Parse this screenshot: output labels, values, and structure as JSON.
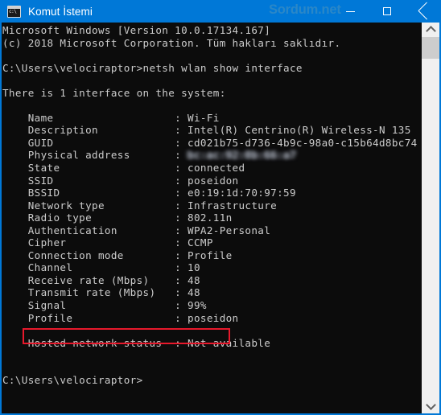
{
  "window": {
    "title": "Komut İstemi",
    "app_icon": "cmd-console-icon",
    "watermark": "Sordum.net",
    "controls": {
      "minimize_label": "Minimize",
      "maximize_label": "Maximize",
      "close_label": "Close"
    },
    "accent_color": "#0078d7",
    "console_bg": "#0c0c0c",
    "console_fg": "#cccccc",
    "highlight_color": "#e8192c"
  },
  "console": {
    "lines": [
      {
        "text": "Microsoft Windows [Version 10.0.17134.167]"
      },
      {
        "text": "(c) 2018 Microsoft Corporation. Tüm hakları saklıdır."
      },
      {
        "text": ""
      },
      {
        "text": "C:\\Users\\velociraptor>netsh wlan show interface"
      },
      {
        "text": ""
      },
      {
        "text": "There is 1 interface on the system:"
      },
      {
        "text": ""
      },
      {
        "text": "    Name                   : Wi-Fi"
      },
      {
        "text": "    Description            : Intel(R) Centrino(R) Wireless-N 135"
      },
      {
        "text": "    GUID                   : cd021b75-d736-4b9c-98a0-c15b64d8bc74"
      },
      {
        "text": "    Physical address       : ",
        "blurred_suffix": "bc:ac:92:0b:66:a7",
        "redacted": true
      },
      {
        "text": "    State                  : connected"
      },
      {
        "text": "    SSID                   : poseidon"
      },
      {
        "text": "    BSSID                  : e0:19:1d:70:97:59"
      },
      {
        "text": "    Network type           : Infrastructure"
      },
      {
        "text": "    Radio type             : 802.11n"
      },
      {
        "text": "    Authentication         : WPA2-Personal"
      },
      {
        "text": "    Cipher                 : CCMP"
      },
      {
        "text": "    Connection mode        : Profile"
      },
      {
        "text": "    Channel                : 10"
      },
      {
        "text": "    Receive rate (Mbps)    : 48"
      },
      {
        "text": "    Transmit rate (Mbps)   : 48"
      },
      {
        "text": "    Signal                 : 99%"
      },
      {
        "text": "    Profile                : poseidon"
      },
      {
        "text": ""
      },
      {
        "text": "    Hosted network status  : Not available"
      },
      {
        "text": ""
      },
      {
        "text": ""
      },
      {
        "text": "C:\\Users\\velociraptor>"
      }
    ],
    "highlighted_line": "    Signal                 : 99%"
  },
  "scrollbar": {
    "up_arrow": "chevron-up-icon",
    "down_arrow": "chevron-down-icon",
    "thumb_label": "scroll-thumb"
  }
}
